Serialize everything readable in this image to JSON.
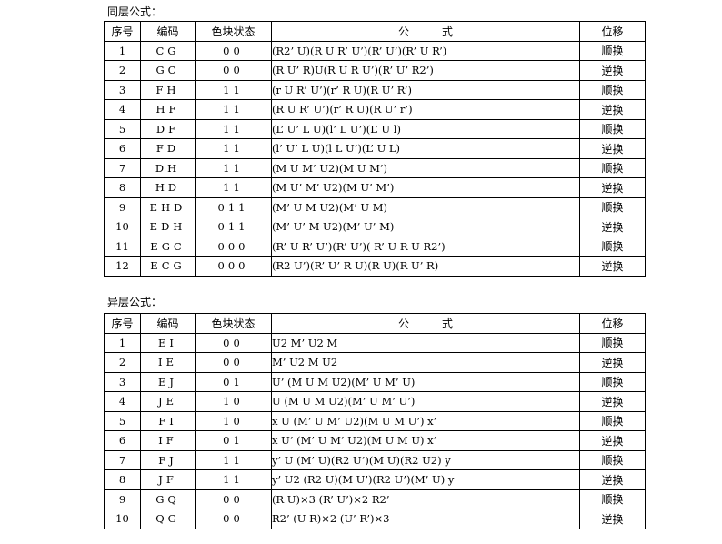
{
  "same_layer": {
    "caption": "同层公式：",
    "headers": {
      "index": "序号",
      "code": "编码",
      "state": "色块状态",
      "formula": "公　　　式",
      "move": "位移"
    },
    "rows": [
      {
        "index": "1",
        "code": "CG",
        "state": "00",
        "formula": "(R2’ U)(R U R’ U’)(R’ U’)(R’ U R’)",
        "move": "顺换"
      },
      {
        "index": "2",
        "code": "GC",
        "state": "00",
        "formula": "(R U’ R)U(R U R U’)(R’ U’ R2’)",
        "move": "逆换"
      },
      {
        "index": "3",
        "code": "FH",
        "state": "11",
        "formula": "(r U R’ U’)(r’ R U)(R U’ R’)",
        "move": "顺换"
      },
      {
        "index": "4",
        "code": "HF",
        "state": "11",
        "formula": "(R U R’ U’)(r’ R U)(R U’ r’)",
        "move": "逆换"
      },
      {
        "index": "5",
        "code": "DF",
        "state": "11",
        "formula": "(L’ U’ L U)(l’ L U’)(L’ U l)",
        "move": "顺换"
      },
      {
        "index": "6",
        "code": "FD",
        "state": "11",
        "formula": "(l’ U’ L U)(l L U’)(L’ U L)",
        "move": "逆换"
      },
      {
        "index": "7",
        "code": "DH",
        "state": "11",
        "formula": "(M U M’ U2)(M U M’)",
        "move": "顺换"
      },
      {
        "index": "8",
        "code": "HD",
        "state": "11",
        "formula": "(M U’ M’ U2)(M U’ M’)",
        "move": "逆换"
      },
      {
        "index": "9",
        "code": "EHD",
        "state": "011",
        "formula": "(M’ U M U2)(M’ U M)",
        "move": "顺换"
      },
      {
        "index": "10",
        "code": "EDH",
        "state": "011",
        "formula": "(M’ U’ M U2)(M’ U’ M)",
        "move": "逆换"
      },
      {
        "index": "11",
        "code": "EGC",
        "state": "000",
        "formula": "(R’ U R’ U’)(R’ U’)( R’ U R U R2’)",
        "move": "顺换"
      },
      {
        "index": "12",
        "code": "ECG",
        "state": "000",
        "formula": "(R2 U’)(R’ U’ R U)(R U)(R U’ R)",
        "move": "逆换"
      }
    ]
  },
  "diff_layer": {
    "caption": "异层公式：",
    "headers": {
      "index": "序号",
      "code": "编码",
      "state": "色块状态",
      "formula": "公　　　式",
      "move": "位移"
    },
    "rows": [
      {
        "index": "1",
        "code": "EI",
        "state": "00",
        "formula": "U2 M’ U2 M",
        "move": "顺换"
      },
      {
        "index": "2",
        "code": "IE",
        "state": "00",
        "formula": "M’ U2 M U2",
        "move": "逆换"
      },
      {
        "index": "3",
        "code": "EJ",
        "state": "01",
        "formula": "U’ (M U M U2)(M’ U M’ U)",
        "move": "顺换"
      },
      {
        "index": "4",
        "code": "JE",
        "state": "10",
        "formula": "U (M U M U2)(M’ U M’ U’)",
        "move": "逆换"
      },
      {
        "index": "5",
        "code": "FI",
        "state": "10",
        "formula": "x U (M’ U M’ U2)(M U M U’) x’",
        "move": "顺换"
      },
      {
        "index": "6",
        "code": "IF",
        "state": "01",
        "formula": "x U’ (M’ U M’ U2)(M U M U) x’",
        "move": "逆换"
      },
      {
        "index": "7",
        "code": "FJ",
        "state": "11",
        "formula": "y’ U (M’ U)(R2 U’)(M U)(R2 U2) y",
        "move": "顺换"
      },
      {
        "index": "8",
        "code": "JF",
        "state": "11",
        "formula": "y’ U2 (R2 U)(M U’)(R2 U’)(M’ U) y",
        "move": "逆换"
      },
      {
        "index": "9",
        "code": "GQ",
        "state": "00",
        "formula": "(R U)×3 (R’ U’)×2 R2’",
        "move": "顺换"
      },
      {
        "index": "10",
        "code": "QG",
        "state": "00",
        "formula": "R2’ (U R)×2 (U’ R’)×3",
        "move": "逆换"
      }
    ]
  }
}
